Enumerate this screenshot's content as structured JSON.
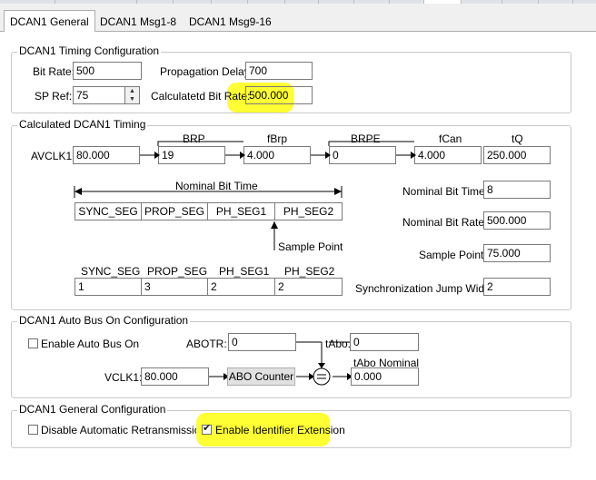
{
  "top_tabs": [
    "",
    "",
    "",
    "",
    "",
    "",
    "",
    "",
    "",
    "",
    "",
    ""
  ],
  "tabs": [
    {
      "label": "DCAN1 General",
      "active": true
    },
    {
      "label": "DCAN1 Msg1-8",
      "active": false
    },
    {
      "label": "DCAN1 Msg9-16",
      "active": false
    }
  ],
  "timing_config": {
    "title": "DCAN1 Timing Configuration",
    "bit_rate_label": "Bit Rate:",
    "bit_rate": "500",
    "prop_delay_label": "Propagation Delay:",
    "prop_delay": "700",
    "sp_ref_label": "SP Ref:",
    "sp_ref": "75",
    "calc_bit_rate_label": "Calculatetd Bit Rate:",
    "calc_bit_rate": "500.000"
  },
  "calc_timing": {
    "title": "Calculated DCAN1 Timing",
    "avclk1_label": "AVCLK1:",
    "avclk1": "80.000",
    "brp_label": "BRP",
    "brp": "19",
    "fbrp_label": "fBrp",
    "fbrp": "4.000",
    "brpe_label": "BRPE",
    "brpe": "0",
    "fcan_label": "fCan",
    "fcan": "4.000",
    "tq_label": "tQ",
    "tq": "250.000",
    "nominal_bit_time_caption": "Nominal Bit Time",
    "segments": [
      "SYNC_SEG",
      "PROP_SEG",
      "PH_SEG1",
      "PH_SEG2"
    ],
    "sample_point_caption": "Sample Point",
    "seg_labels": [
      "SYNC_SEG",
      "PROP_SEG",
      "PH_SEG1",
      "PH_SEG2"
    ],
    "seg_values": [
      "1",
      "3",
      "2",
      "2"
    ],
    "nominal_bit_time_label": "Nominal Bit Time:",
    "nominal_bit_time": "8",
    "nominal_bit_rate_label": "Nominal Bit Rate:",
    "nominal_bit_rate": "500.000",
    "sample_point_label": "Sample Point:",
    "sample_point": "75.000",
    "sjw_label": "Synchronization Jump Width:",
    "sjw": "2"
  },
  "auto_bus": {
    "title": "DCAN1 Auto Bus On Configuration",
    "enable_label": "Enable Auto Bus On",
    "enable_checked": false,
    "abotr_label": "ABOTR:",
    "abotr": "0",
    "tabo_label": "tAbo:",
    "tabo": "0",
    "vclk1_label": "VCLK1:",
    "vclk1": "80.000",
    "abo_counter_label": "ABO Counter",
    "equals_symbol": "=",
    "tabo_nominal_label": "tAbo Nominal",
    "tabo_nominal": "0.000"
  },
  "general_config": {
    "title": "DCAN1 General Configuration",
    "disable_retrans_label": "Disable Automatic Retransmission",
    "disable_retrans_checked": false,
    "enable_id_ext_label": "Enable Identifier Extension",
    "enable_id_ext_checked": true
  },
  "colors": {
    "highlight": "#ffff33",
    "group_border": "#c8c8c8",
    "field_border": "#7a7a7a"
  }
}
